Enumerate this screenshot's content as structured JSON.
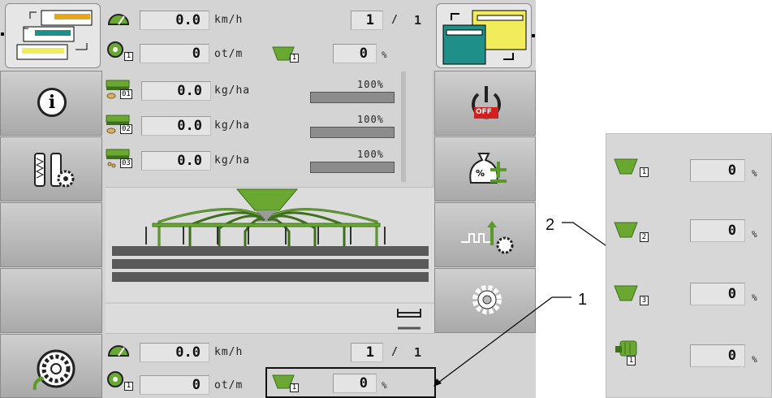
{
  "top": {
    "speed_value": "0.0",
    "speed_unit": "km/h",
    "counter_a": "1",
    "counter_b": "1",
    "counter_sep": "/",
    "rpm_value": "0",
    "rpm_unit": "ot/m",
    "rpm_idx": "1",
    "hopper_idx": "1",
    "hopper_value": "0",
    "hopper_unit": "%"
  },
  "rates": [
    {
      "idx": "01",
      "value": "0.0",
      "unit": "kg/ha",
      "pct": "100%"
    },
    {
      "idx": "02",
      "value": "0.0",
      "unit": "kg/ha",
      "pct": "100%"
    },
    {
      "idx": "03",
      "value": "0.0",
      "unit": "kg/ha",
      "pct": "100%"
    }
  ],
  "bottom": {
    "speed_value": "0.0",
    "speed_unit": "km/h",
    "counter_a": "1",
    "counter_b": "1",
    "counter_sep": "/",
    "rpm_value": "0",
    "rpm_unit": "ot/m",
    "rpm_idx": "1",
    "hopper_idx": "1",
    "hopper_value": "0",
    "hopper_unit": "%"
  },
  "off_label": "OFF",
  "info_glyph": "i",
  "percent_glyph": "%",
  "callouts": {
    "one": "1",
    "two": "2"
  },
  "right_panel": [
    {
      "idx": "1",
      "value": "0",
      "unit": "%",
      "icon": "hopper-icon"
    },
    {
      "idx": "2",
      "value": "0",
      "unit": "%",
      "icon": "hopper-icon"
    },
    {
      "idx": "3",
      "value": "0",
      "unit": "%",
      "icon": "hopper-icon"
    },
    {
      "idx": "1",
      "value": "0",
      "unit": "%",
      "icon": "metering-unit-icon"
    }
  ],
  "colors": {
    "green": "#6aa832",
    "teal": "#1f8f8a",
    "yellow": "#f0ec5a",
    "red": "#d21f1f"
  }
}
